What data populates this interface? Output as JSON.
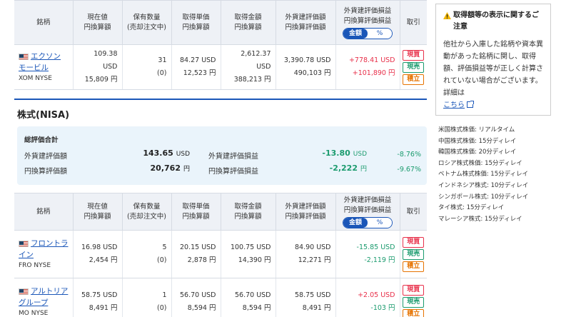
{
  "table_headers": {
    "name": "銘柄",
    "price_a": "現在値",
    "price_b": "円換算額",
    "qty_a": "保有数量",
    "qty_b": "(売却注文中)",
    "cost_a": "取得単価",
    "cost_b": "円換算額",
    "costamt_a": "取得金額",
    "costamt_b": "円換算額",
    "val_a": "外貨建評価額",
    "val_b": "円換算評価額",
    "pl_a": "外貨建評価損益",
    "pl_b": "円換算評価損益",
    "toggle_amount": "金額",
    "toggle_pct": "%",
    "trade": "取引"
  },
  "trade_buttons": {
    "buy": "現買",
    "sell": "現売",
    "accumulate": "積立"
  },
  "holdings_top": [
    {
      "name": "エクソン モービル",
      "code": "XOM NYSE",
      "price": "109.38 USD",
      "price_jpy": "15,809 円",
      "qty": "31",
      "qty_selling": "(0)",
      "cost": "84.27 USD",
      "cost_jpy": "12,523 円",
      "cost_amt": "2,612.37 USD",
      "cost_amt_jpy": "388,213 円",
      "value": "3,390.78 USD",
      "value_jpy": "490,103 円",
      "pl": "+778.41 USD",
      "pl_jpy": "+101,890 円",
      "pl_sign": "pos"
    }
  ],
  "section_title": "株式(NISA)",
  "summary": {
    "title": "総評価合計",
    "foreign_value_label": "外貨建評価額",
    "foreign_value": "143.65",
    "foreign_value_unit": "USD",
    "jpy_value_label": "円換算評価額",
    "jpy_value": "20,762",
    "jpy_value_unit": "円",
    "foreign_pl_label": "外貨建評価損益",
    "foreign_pl": "-13.80",
    "foreign_pl_unit": "USD",
    "foreign_pl_pct": "-8.76%",
    "jpy_pl_label": "円換算評価損益",
    "jpy_pl": "-2,222",
    "jpy_pl_unit": "円",
    "jpy_pl_pct": "-9.67%"
  },
  "holdings_nisa": [
    {
      "name": "フロントラ イン",
      "code": "FRO NYSE",
      "price": "16.98 USD",
      "price_jpy": "2,454 円",
      "qty": "5",
      "qty_selling": "(0)",
      "cost": "20.15 USD",
      "cost_jpy": "2,878 円",
      "cost_amt": "100.75 USD",
      "cost_amt_jpy": "14,390 円",
      "value": "84.90 USD",
      "value_jpy": "12,271 円",
      "pl": "-15.85 USD",
      "pl_jpy": "-2,119 円",
      "pl_sign": "neg"
    },
    {
      "name": "アルトリア グループ",
      "code": "MO NYSE",
      "price": "58.75 USD",
      "price_jpy": "8,491 円",
      "qty": "1",
      "qty_selling": "(0)",
      "cost": "56.70 USD",
      "cost_jpy": "8,594 円",
      "cost_amt": "56.70 USD",
      "cost_amt_jpy": "8,594 円",
      "value": "58.75 USD",
      "value_jpy": "8,491 円",
      "pl": "+2.05 USD",
      "pl_jpy": "-103 円",
      "pl_sign": "mixed"
    }
  ],
  "notice": {
    "title": "取得額等の表示に関するご注意",
    "body": "他社から入庫した銘柄や資本異動があった銘柄に関し、取得額、評価損益等が正しく計算されていない場合がございます。詳細は",
    "link": "こちら"
  },
  "delays": [
    "米国株式株価: リアルタイム",
    "中国株式株価: 15分ディレイ",
    "韓国株式株価: 20分ディレイ",
    "ロシア株式株価: 15分ディレイ",
    "ベトナム株式株価: 15分ディレイ",
    "インドネシア株式: 10分ディレイ",
    "シンガポール株式: 10分ディレイ",
    "タイ株式: 15分ディレイ",
    "マレーシア株式: 15分ディレイ"
  ],
  "colors": {
    "accent": "#1a56b8",
    "positive": "#e8304a",
    "negative": "#1b9b6e",
    "accumulate": "#e67300",
    "summary_bg": "#eaf4fb"
  }
}
